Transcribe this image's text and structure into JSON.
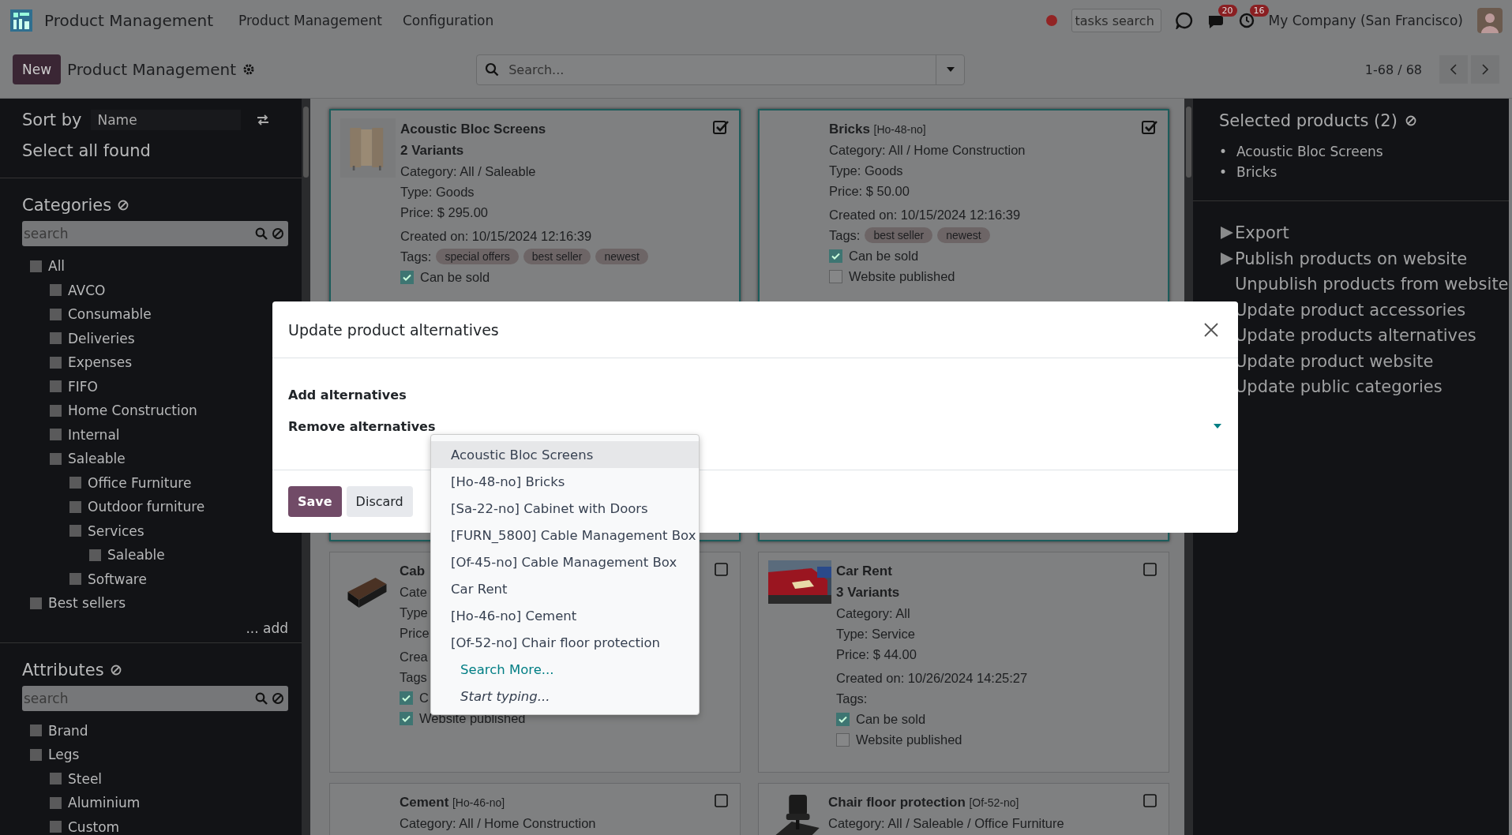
{
  "navbar": {
    "app_name": "Product Management",
    "menus": [
      "Product Management",
      "Configuration"
    ],
    "tasks_search_placeholder": "tasks search",
    "messages_badge": "20",
    "activities_badge": "16",
    "company": "My Company (San Francisco)"
  },
  "control_panel": {
    "new_button": "New",
    "title": "Product Management",
    "search_placeholder": "Search...",
    "pager": "1-68 / 68"
  },
  "left_panel": {
    "sort_label": "Sort by",
    "sort_value": "Name",
    "select_all": "Select all found",
    "categories": {
      "title": "Categories",
      "search_placeholder": "search",
      "add_link": "... add",
      "tree": [
        {
          "label": "All",
          "checked": false,
          "children": [
            {
              "label": "AVCO",
              "checked": false
            },
            {
              "label": "Consumable",
              "checked": false
            },
            {
              "label": "Deliveries",
              "checked": false
            },
            {
              "label": "Expenses",
              "checked": false
            },
            {
              "label": "FIFO",
              "checked": false
            },
            {
              "label": "Home Construction",
              "checked": false
            },
            {
              "label": "Internal",
              "checked": false
            },
            {
              "label": "Saleable",
              "checked": false,
              "children": [
                {
                  "label": "Office Furniture",
                  "checked": false
                },
                {
                  "label": "Outdoor furniture",
                  "checked": false
                },
                {
                  "label": "Services",
                  "checked": false,
                  "children": [
                    {
                      "label": "Saleable",
                      "checked": false
                    }
                  ]
                },
                {
                  "label": "Software",
                  "checked": false
                }
              ]
            }
          ]
        },
        {
          "label": "Best sellers",
          "checked": false
        }
      ]
    },
    "attributes": {
      "title": "Attributes",
      "search_placeholder": "search",
      "tree": [
        {
          "label": "Brand",
          "checked": false
        },
        {
          "label": "Legs",
          "checked": false,
          "children": [
            {
              "label": "Steel",
              "checked": false
            },
            {
              "label": "Aluminium",
              "checked": false
            },
            {
              "label": "Custom",
              "checked": false
            }
          ]
        }
      ]
    }
  },
  "cards": [
    {
      "name": "Acoustic Bloc Screens",
      "variants": "2 Variants",
      "image": true,
      "selected": true,
      "lines": [
        "Category: All / Saleable",
        "Type: Goods",
        "Price: $ 295.00"
      ],
      "created": "Created on: 10/15/2024 12:16:39",
      "tags_label": "Tags:",
      "tags": [
        "special offers",
        "best seller",
        "newest"
      ],
      "flags": [
        {
          "label": "Can be sold",
          "checked": true
        }
      ]
    },
    {
      "name": "Bricks",
      "code": "[Ho-48-no]",
      "image": false,
      "selected": true,
      "lines": [
        "Category: All / Home Construction",
        "Type: Goods",
        "Price: $ 50.00"
      ],
      "created": "Created on: 10/15/2024 12:16:39",
      "tags_label": "Tags:",
      "tags": [
        "best seller",
        "newest"
      ],
      "flags": [
        {
          "label": "Can be sold",
          "checked": true
        },
        {
          "label": "Website published",
          "checked": false
        }
      ]
    },
    {
      "name": "Cab",
      "image": true,
      "selected": false,
      "lines": [
        "Cate",
        "Type",
        "Price"
      ],
      "created": "Crea",
      "tags_label": "Tags",
      "flags": [
        {
          "label": "C",
          "checked": true
        },
        {
          "label": "Website published",
          "checked": true
        }
      ]
    },
    {
      "name": "Car Rent",
      "variants": "3 Variants",
      "image": true,
      "selected": false,
      "lines": [
        "Category: All",
        "Type: Service",
        "Price: $ 44.00"
      ],
      "created": "Created on: 10/26/2024 14:25:27",
      "tags_label": "Tags:",
      "flags": [
        {
          "label": "Can be sold",
          "checked": true
        },
        {
          "label": "Website published",
          "checked": false
        }
      ]
    },
    {
      "name": "Cement",
      "code": "[Ho-46-no]",
      "image": false,
      "selected": false,
      "lines": [
        "Category: All / Home Construction"
      ]
    },
    {
      "name": "Chair floor protection",
      "code": "[Of-52-no]",
      "image": true,
      "selected": false,
      "lines": [
        "Category: All / Saleable / Office Furniture"
      ]
    }
  ],
  "right_panel": {
    "title": "Selected products (2)",
    "bullet": "•",
    "selected_products": [
      "Acoustic Bloc Screens",
      "Bricks"
    ],
    "actions": [
      {
        "label": "Export",
        "marker": true
      },
      {
        "label": "Publish products on website",
        "marker": true
      },
      {
        "label": "Unpublish products from website",
        "marker": false
      },
      {
        "label": "Update product accessories",
        "marker": false
      },
      {
        "label": "Update products alternatives",
        "marker": false
      },
      {
        "label": "Update product website",
        "marker": false
      },
      {
        "label": "Update public categories",
        "marker": false
      }
    ]
  },
  "dialog": {
    "title": "Update product alternatives",
    "fields": [
      "Add alternatives",
      "Remove alternatives"
    ],
    "dropdown": {
      "options": [
        {
          "label": "Acoustic Bloc Screens",
          "selected": true
        },
        {
          "label": "[Ho-48-no] Bricks",
          "selected": false
        },
        {
          "label": "[Sa-22-no] Cabinet with Doors",
          "selected": false
        },
        {
          "label": "[FURN_5800] Cable Management Box",
          "selected": false
        },
        {
          "label": "[Of-45-no] Cable Management Box",
          "selected": false
        },
        {
          "label": "Car Rent",
          "selected": false
        },
        {
          "label": "[Ho-46-no] Cement",
          "selected": false
        },
        {
          "label": "[Of-52-no] Chair floor protection",
          "selected": false
        }
      ],
      "search_more": "Search More...",
      "hint": "Start typing..."
    },
    "buttons": [
      {
        "label": "Save",
        "kind": "primary"
      },
      {
        "label": "Discard",
        "kind": "secondary"
      }
    ]
  }
}
